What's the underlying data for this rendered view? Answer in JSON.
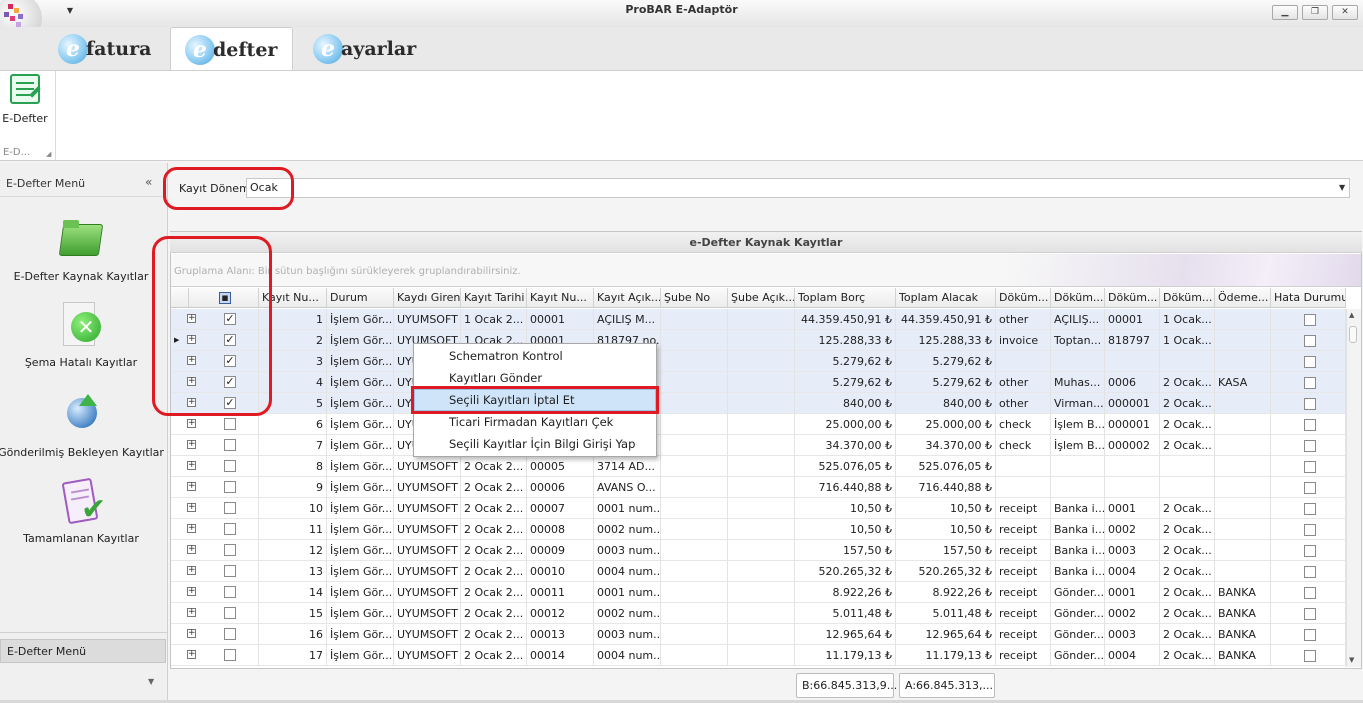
{
  "window": {
    "title": "ProBAR E-Adaptör",
    "controls": [
      "minimize",
      "restore",
      "close"
    ]
  },
  "tabs": [
    {
      "letter": "e",
      "label": "fatura"
    },
    {
      "letter": "e",
      "label": "defter"
    },
    {
      "letter": "e",
      "label": "ayarlar"
    }
  ],
  "ribbon": {
    "button_label": "E-Defter",
    "group_caption": "E-D..."
  },
  "nav": {
    "header": "E-Defter Menü",
    "items": [
      {
        "label": "E-Defter Kaynak Kayıtlar",
        "icon": "folder-icon"
      },
      {
        "label": "Şema Hatalı Kayıtlar",
        "icon": "error-icon"
      },
      {
        "label": "Gönderilmiş Bekleyen Kayıtlar",
        "icon": "globe-upload-icon"
      },
      {
        "label": "Tamamlanan Kayıtlar",
        "icon": "checklist-icon"
      }
    ],
    "bottom": "E-Defter Menü"
  },
  "filter": {
    "label": "Kayıt Dönemi",
    "value": "Ocak"
  },
  "grid": {
    "title": "e-Defter Kaynak Kayıtlar",
    "group_hint": "Gruplama Alanı: Bir sütun başlığını sürükleyerek gruplandırabilirsiniz.",
    "columns": [
      "Kayıt Nu...",
      "Durum",
      "Kaydı Giren",
      "Kayıt Tarihi",
      "Kayıt Nu...",
      "Kayıt Açık...",
      "Şube No",
      "Şube Açık...",
      "Toplam Borç",
      "Toplam Alacak",
      "Döküm...",
      "Döküm...",
      "Döküm...",
      "Döküm...",
      "Ödeme...",
      "Hata Durumu"
    ],
    "rows": [
      {
        "checked": true,
        "cells": [
          "1",
          "İşlem Gör...",
          "UYUMSOFT",
          "1 Ocak 2...",
          "00001",
          "AÇILIŞ M...",
          "",
          "",
          "44.359.450,91 ₺",
          "44.359.450,91 ₺",
          "other",
          "AÇILIŞ...",
          "00001",
          "1 Ocak...",
          "",
          ""
        ]
      },
      {
        "checked": true,
        "cells": [
          "2",
          "İşlem Gör...",
          "UYUMSOFT",
          "1 Ocak 2...",
          "00001",
          "818797 no...",
          "",
          "",
          "125.288,33 ₺",
          "125.288,33 ₺",
          "invoice",
          "Toptan...",
          "818797",
          "1 Ocak...",
          "",
          ""
        ]
      },
      {
        "checked": true,
        "cells": [
          "3",
          "İşlem Gör...",
          "UYUMSOFT",
          "",
          "",
          "",
          "",
          "",
          "5.279,62 ₺",
          "5.279,62 ₺",
          "",
          "",
          "",
          "",
          "",
          ""
        ]
      },
      {
        "checked": true,
        "cells": [
          "4",
          "İşlem Gör...",
          "UYUMSOFT",
          "",
          "",
          "",
          "",
          "",
          "5.279,62 ₺",
          "5.279,62 ₺",
          "other",
          "Muhas...",
          "0006",
          "2 Ocak...",
          "KASA",
          ""
        ]
      },
      {
        "checked": true,
        "cells": [
          "5",
          "İşlem Gör...",
          "UYUMSOFT",
          "",
          "",
          "",
          "",
          "",
          "840,00 ₺",
          "840,00 ₺",
          "other",
          "Virman...",
          "000001",
          "2 Ocak...",
          "",
          ""
        ]
      },
      {
        "checked": false,
        "cells": [
          "6",
          "İşlem Gör...",
          "UYUMSOFT",
          "",
          "",
          "",
          "",
          "",
          "25.000,00 ₺",
          "25.000,00 ₺",
          "check",
          "İşlem B...",
          "000001",
          "2 Ocak...",
          "",
          ""
        ]
      },
      {
        "checked": false,
        "cells": [
          "7",
          "İşlem Gör...",
          "UYUMSOFT",
          "",
          "",
          "",
          "",
          "",
          "34.370,00 ₺",
          "34.370,00 ₺",
          "check",
          "İşlem B...",
          "000002",
          "2 Ocak...",
          "",
          ""
        ]
      },
      {
        "checked": false,
        "cells": [
          "8",
          "İşlem Gör...",
          "UYUMSOFT",
          "2 Ocak 2...",
          "00005",
          "3714 AD...",
          "",
          "",
          "525.076,05 ₺",
          "525.076,05 ₺",
          "",
          "",
          "",
          "",
          "",
          ""
        ]
      },
      {
        "checked": false,
        "cells": [
          "9",
          "İşlem Gör...",
          "UYUMSOFT",
          "2 Ocak 2...",
          "00006",
          "AVANS O...",
          "",
          "",
          "716.440,88 ₺",
          "716.440,88 ₺",
          "",
          "",
          "",
          "",
          "",
          ""
        ]
      },
      {
        "checked": false,
        "cells": [
          "10",
          "İşlem Gör...",
          "UYUMSOFT",
          "2 Ocak 2...",
          "00007",
          "0001 num...",
          "",
          "",
          "10,50 ₺",
          "10,50 ₺",
          "receipt",
          "Banka i...",
          "0001",
          "2 Ocak...",
          "",
          ""
        ]
      },
      {
        "checked": false,
        "cells": [
          "11",
          "İşlem Gör...",
          "UYUMSOFT",
          "2 Ocak 2...",
          "00008",
          "0002 num...",
          "",
          "",
          "10,50 ₺",
          "10,50 ₺",
          "receipt",
          "Banka i...",
          "0002",
          "2 Ocak...",
          "",
          ""
        ]
      },
      {
        "checked": false,
        "cells": [
          "12",
          "İşlem Gör...",
          "UYUMSOFT",
          "2 Ocak 2...",
          "00009",
          "0003 num...",
          "",
          "",
          "157,50 ₺",
          "157,50 ₺",
          "receipt",
          "Banka i...",
          "0003",
          "2 Ocak...",
          "",
          ""
        ]
      },
      {
        "checked": false,
        "cells": [
          "13",
          "İşlem Gör...",
          "UYUMSOFT",
          "2 Ocak 2...",
          "00010",
          "0004 num...",
          "",
          "",
          "520.265,32 ₺",
          "520.265,32 ₺",
          "receipt",
          "Banka i...",
          "0004",
          "2 Ocak...",
          "",
          ""
        ]
      },
      {
        "checked": false,
        "cells": [
          "14",
          "İşlem Gör...",
          "UYUMSOFT",
          "2 Ocak 2...",
          "00011",
          "0001 num...",
          "",
          "",
          "8.922,26 ₺",
          "8.922,26 ₺",
          "receipt",
          "Gönder...",
          "0001",
          "2 Ocak...",
          "BANKA",
          ""
        ]
      },
      {
        "checked": false,
        "cells": [
          "15",
          "İşlem Gör...",
          "UYUMSOFT",
          "2 Ocak 2...",
          "00012",
          "0002 num...",
          "",
          "",
          "5.011,48 ₺",
          "5.011,48 ₺",
          "receipt",
          "Gönder...",
          "0002",
          "2 Ocak...",
          "BANKA",
          ""
        ]
      },
      {
        "checked": false,
        "cells": [
          "16",
          "İşlem Gör...",
          "UYUMSOFT",
          "2 Ocak 2...",
          "00013",
          "0003 num...",
          "",
          "",
          "12.965,64 ₺",
          "12.965,64 ₺",
          "receipt",
          "Gönder...",
          "0003",
          "2 Ocak...",
          "BANKA",
          ""
        ]
      },
      {
        "checked": false,
        "cells": [
          "17",
          "İşlem Gör...",
          "UYUMSOFT",
          "2 Ocak 2...",
          "00014",
          "0004 num...",
          "",
          "",
          "11.179,13 ₺",
          "11.179,13 ₺",
          "receipt",
          "Gönder...",
          "0004",
          "2 Ocak...",
          "BANKA",
          ""
        ]
      }
    ],
    "current_row": 2
  },
  "context_menu": {
    "items": [
      "Schematron Kontrol",
      "Kayıtları Gönder",
      "Seçili Kayıtları İptal Et",
      "Ticari Firmadan Kayıtları Çek",
      "Seçili Kayıtlar İçin Bilgi Girişi Yap"
    ],
    "highlighted": 2
  },
  "footer": {
    "sum_borc": "B:66.845.313,9...",
    "sum_alacak": "A:66.845.313,..."
  },
  "colors": {
    "annotation": "#e01a22",
    "selected_row": "#e6ecf8",
    "menu_highlight": "#cfe4f8"
  }
}
